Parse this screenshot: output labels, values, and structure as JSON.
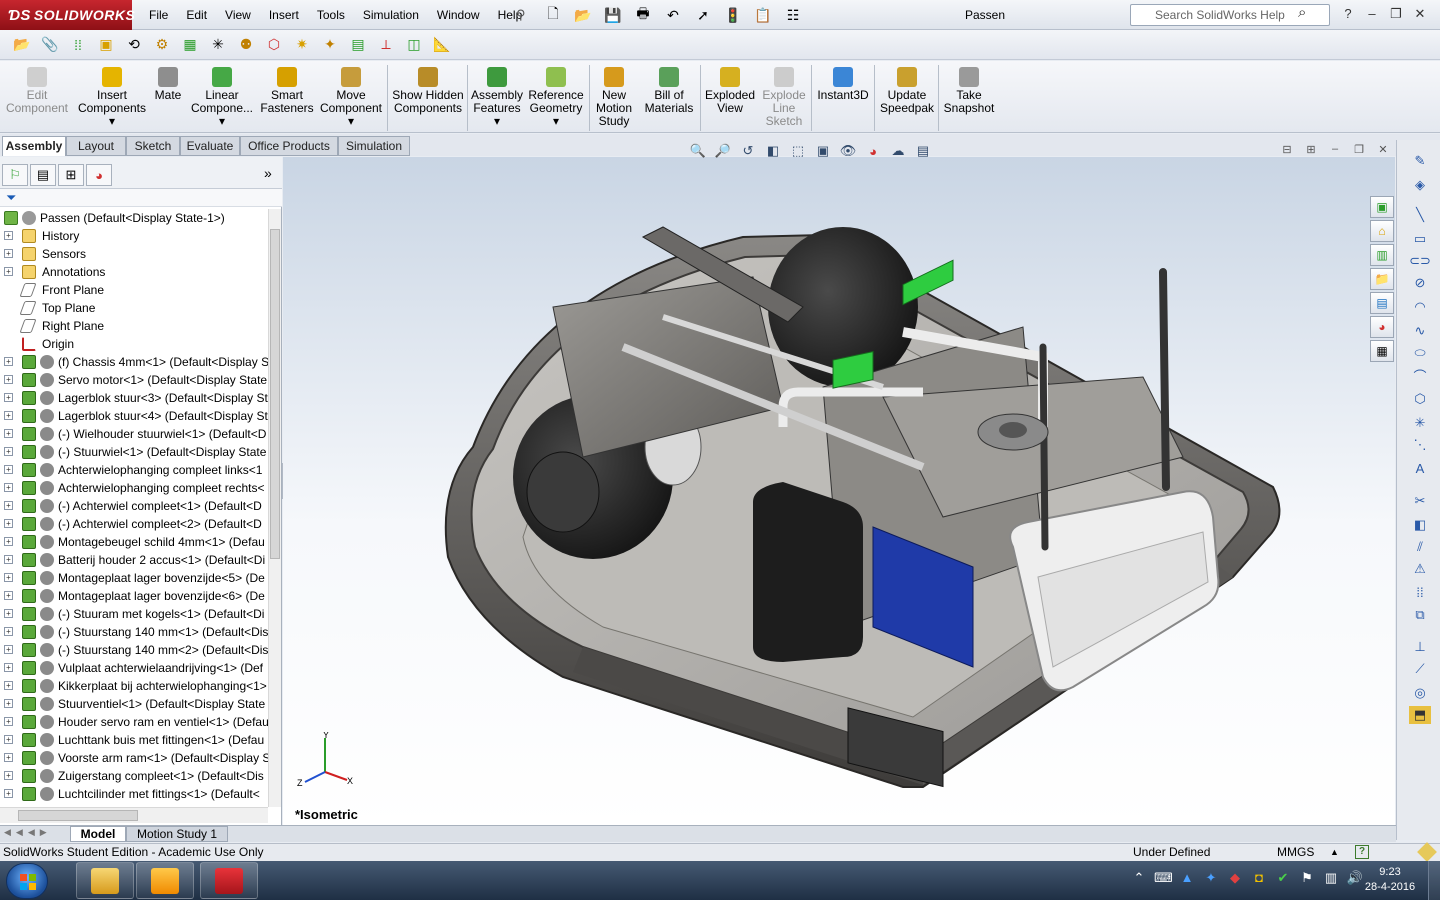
{
  "app": {
    "logo_text": "SOLIDWORKS",
    "doc_title": "Passen",
    "help_search_placeholder": "Search SolidWorks Help"
  },
  "menu": [
    "File",
    "Edit",
    "View",
    "Insert",
    "Tools",
    "Simulation",
    "Window",
    "Help"
  ],
  "commands": [
    {
      "label": "Edit Component",
      "disabled": true
    },
    {
      "label": "Insert Components"
    },
    {
      "label": "Mate"
    },
    {
      "label": "Linear Compone..."
    },
    {
      "label": "Smart Fasteners"
    },
    {
      "label": "Move Component"
    },
    {
      "label": "Show Hidden Components"
    },
    {
      "label": "Assembly Features"
    },
    {
      "label": "Reference Geometry"
    },
    {
      "label": "New Motion Study"
    },
    {
      "label": "Bill of Materials"
    },
    {
      "label": "Exploded View"
    },
    {
      "label": "Explode Line Sketch",
      "disabled": true
    },
    {
      "label": "Instant3D"
    },
    {
      "label": "Update Speedpak"
    },
    {
      "label": "Take Snapshot"
    }
  ],
  "tabs": [
    "Assembly",
    "Layout",
    "Sketch",
    "Evaluate",
    "Office Products",
    "Simulation"
  ],
  "tree": {
    "root": "Passen  (Default<Display State-1>)",
    "items": [
      {
        "label": "History",
        "kind": "folder"
      },
      {
        "label": "Sensors",
        "kind": "folder"
      },
      {
        "label": "Annotations",
        "kind": "annot"
      },
      {
        "label": "Front Plane",
        "kind": "plane"
      },
      {
        "label": "Top Plane",
        "kind": "plane"
      },
      {
        "label": "Right Plane",
        "kind": "plane"
      },
      {
        "label": "Origin",
        "kind": "origin"
      },
      {
        "label": "(f) Chassis 4mm<1> (Default<Display S",
        "kind": "part"
      },
      {
        "label": "Servo motor<1> (Default<Display State",
        "kind": "part"
      },
      {
        "label": "Lagerblok stuur<3> (Default<Display St",
        "kind": "part"
      },
      {
        "label": "Lagerblok stuur<4> (Default<Display St",
        "kind": "part"
      },
      {
        "label": "(-) Wielhouder stuurwiel<1> (Default<D",
        "kind": "part"
      },
      {
        "label": "(-) Stuurwiel<1> (Default<Display State",
        "kind": "part"
      },
      {
        "label": "Achterwielophanging compleet links<1",
        "kind": "part"
      },
      {
        "label": "Achterwielophanging compleet rechts<",
        "kind": "part"
      },
      {
        "label": "(-) Achterwiel compleet<1> (Default<D",
        "kind": "part"
      },
      {
        "label": "(-) Achterwiel compleet<2> (Default<D",
        "kind": "part"
      },
      {
        "label": "Montagebeugel schild 4mm<1> (Defau",
        "kind": "part"
      },
      {
        "label": "Batterij houder 2 accus<1> (Default<Di",
        "kind": "part"
      },
      {
        "label": "Montageplaat lager bovenzijde<5> (De",
        "kind": "part"
      },
      {
        "label": "Montageplaat lager bovenzijde<6> (De",
        "kind": "part"
      },
      {
        "label": "(-) Stuuram met kogels<1> (Default<Di",
        "kind": "part"
      },
      {
        "label": "(-) Stuurstang 140 mm<1> (Default<Dis",
        "kind": "part"
      },
      {
        "label": "(-) Stuurstang 140 mm<2> (Default<Dis",
        "kind": "part"
      },
      {
        "label": "Vulplaat achterwielaandrijving<1> (Def",
        "kind": "part"
      },
      {
        "label": "Kikkerplaat bij achterwielophanging<1>",
        "kind": "part"
      },
      {
        "label": "Stuurventiel<1> (Default<Display State",
        "kind": "part"
      },
      {
        "label": "Houder servo ram en ventiel<1> (Defau",
        "kind": "part"
      },
      {
        "label": "Luchttank buis met fittingen<1> (Defau",
        "kind": "part"
      },
      {
        "label": "Voorste arm ram<1> (Default<Display S",
        "kind": "part"
      },
      {
        "label": "Zuigerstang compleet<1> (Default<Dis",
        "kind": "part"
      },
      {
        "label": "Luchtcilinder met fittings<1> (Default<",
        "kind": "part"
      }
    ]
  },
  "viewport": {
    "view_label": "*Isometric",
    "triad": {
      "x": "X",
      "y": "Y",
      "z": "Z"
    }
  },
  "bottom_tabs": [
    "Model",
    "Motion Study 1"
  ],
  "status": {
    "left": "SolidWorks Student Edition - Academic Use Only",
    "state": "Under Defined",
    "units": "MMGS"
  },
  "taskbar": {
    "time": "9:23",
    "date": "28-4-2016",
    "apps": [
      "explorer",
      "outlook",
      "solidworks"
    ]
  },
  "colors": {
    "brand_red": "#c6262e",
    "assembly_gray": "#6e6c6a",
    "tire_black": "#262626",
    "connector_green": "#2ecc40",
    "pcb_blue": "#1f3aa8"
  }
}
